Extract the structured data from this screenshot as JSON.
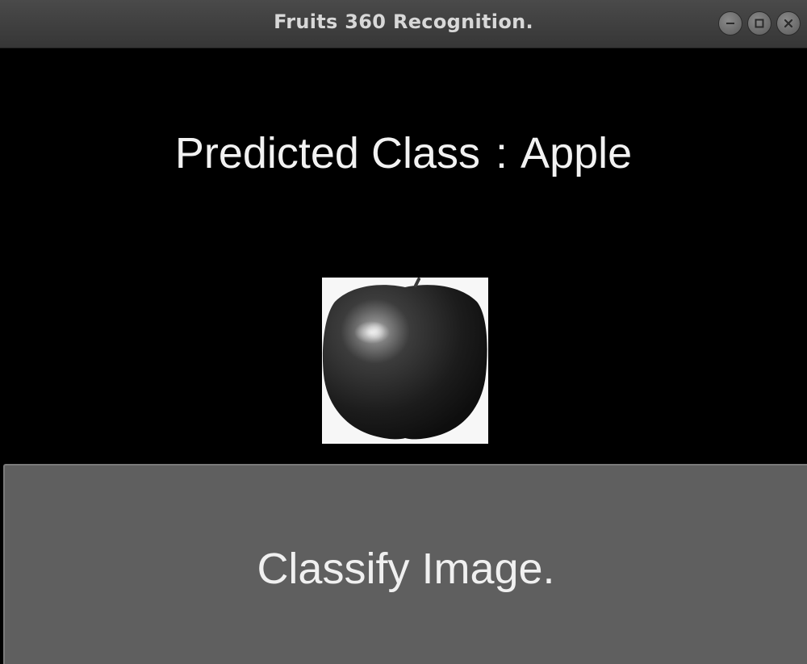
{
  "window": {
    "title": "Fruits 360 Recognition.",
    "controls": [
      "minimize-icon",
      "maximize-icon",
      "close-icon"
    ]
  },
  "prediction": {
    "label": "Predicted Class",
    "separator": ":",
    "value": "Apple"
  },
  "image": {
    "subject": "apple",
    "colors": {
      "frame": "#f7f7f7",
      "fruit_dark": "#1e1e1e",
      "fruit_highlight": "#cfcfcf"
    }
  },
  "classify_button": {
    "label": "Classify Image."
  },
  "colors": {
    "background": "#000000",
    "titlebar": "#3e3e3e",
    "button": "#5f5f5f",
    "text": "#f2f2f2"
  }
}
